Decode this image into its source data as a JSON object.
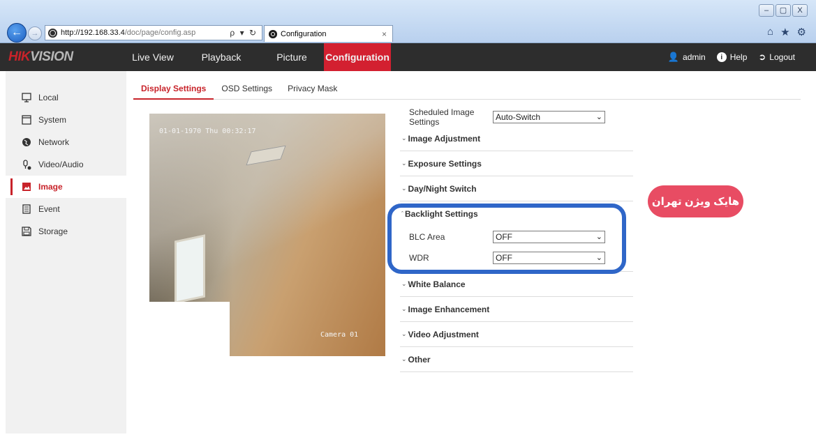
{
  "browser": {
    "window_controls": [
      "–",
      "▢",
      "X"
    ],
    "url_host": "http://192.168.33.4",
    "url_path": "/doc/page/config.asp",
    "address_tools": "ρ ▾ ↻",
    "tab_title": "Configuration",
    "tab_close": "×",
    "toolbar_icons": [
      "home-icon",
      "star-icon",
      "gear-icon"
    ]
  },
  "app": {
    "logo_red": "HIK",
    "logo_rest": "VISION",
    "nav": [
      "Live View",
      "Playback",
      "Picture",
      "Configuration"
    ],
    "nav_active": "Configuration",
    "user": "admin",
    "help": "Help",
    "logout": "Logout"
  },
  "sidebar": {
    "items": [
      {
        "label": "Local",
        "icon": "monitor-icon"
      },
      {
        "label": "System",
        "icon": "window-icon"
      },
      {
        "label": "Network",
        "icon": "globe-icon"
      },
      {
        "label": "Video/Audio",
        "icon": "mic-icon"
      },
      {
        "label": "Image",
        "icon": "image-icon"
      },
      {
        "label": "Event",
        "icon": "list-icon"
      },
      {
        "label": "Storage",
        "icon": "disk-icon"
      }
    ],
    "active": "Image"
  },
  "subtabs": [
    "Display Settings",
    "OSD Settings",
    "Privacy Mask"
  ],
  "subtab_active": "Display Settings",
  "preview": {
    "osd_time": "01-01-1970 Thu 00:32:17",
    "osd_camera": "Camera 01"
  },
  "settings": {
    "scheduled_label": "Scheduled Image Settings",
    "scheduled_value": "Auto-Switch",
    "sections": [
      {
        "title": "Image Adjustment",
        "open": false
      },
      {
        "title": "Exposure Settings",
        "open": false
      },
      {
        "title": "Day/Night Switch",
        "open": false
      },
      {
        "title": "Backlight Settings",
        "open": true
      },
      {
        "title": "White Balance",
        "open": false
      },
      {
        "title": "Image Enhancement",
        "open": false
      },
      {
        "title": "Video Adjustment",
        "open": false
      },
      {
        "title": "Other",
        "open": false
      }
    ],
    "backlight": {
      "blc_label": "BLC Area",
      "blc_value": "OFF",
      "wdr_label": "WDR",
      "wdr_value": "OFF"
    }
  },
  "watermark": "هایک ویژن تهران",
  "colors": {
    "accent": "#c8232a",
    "nav_active_bg": "#d32030",
    "header_bg": "#2d2d2d",
    "highlight": "#2f66c8",
    "watermark_bg": "#e84c63"
  }
}
